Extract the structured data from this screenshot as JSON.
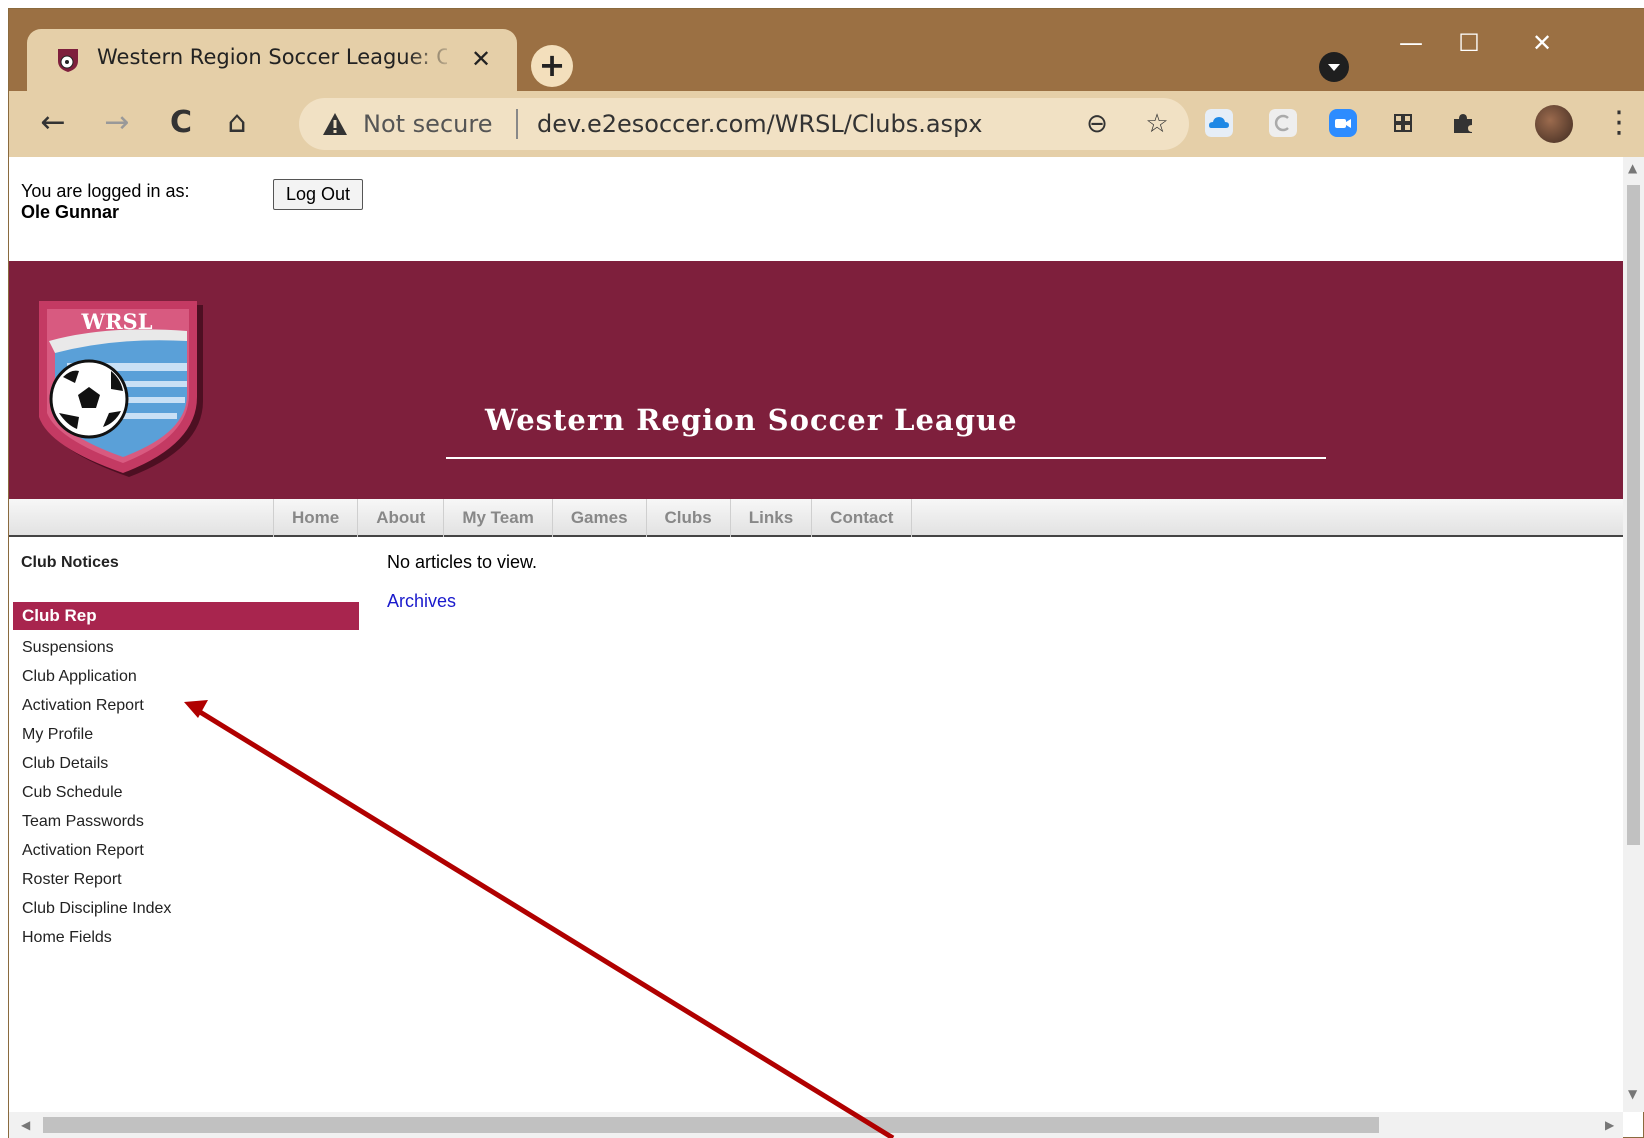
{
  "browser": {
    "tab_title": "Western Region Soccer League: C",
    "tab_close": "✕",
    "new_tab": "+",
    "window": {
      "minimize": "—",
      "maximize": "☐",
      "close": "✕"
    },
    "nav": {
      "back": "←",
      "forward": "→",
      "reload": "C",
      "home": "⌂"
    },
    "security_label": "Not secure",
    "url": "dev.e2esoccer.com/WRSL/Clubs.aspx",
    "zoom_icon": "⊖",
    "star_icon": "☆",
    "menu_icon": "⋮"
  },
  "login": {
    "label": "You are logged in as:",
    "user": "Ole Gunnar",
    "logout_label": "Log Out"
  },
  "banner": {
    "crest_text": "WRSL",
    "title": "Western Region Soccer League"
  },
  "nav_items": [
    "Home",
    "About",
    "My Team",
    "Games",
    "Clubs",
    "Links",
    "Contact"
  ],
  "sidebar": {
    "notices_heading": "Club Notices",
    "section_title": "Club Rep",
    "items": [
      "Suspensions",
      "Club Application",
      "Activation Report",
      "My Profile",
      "Club Details",
      "Cub Schedule",
      "Team Passwords",
      "Activation Report",
      "Roster Report",
      "Club Discipline Index",
      "Home Fields"
    ]
  },
  "main": {
    "message": "No articles to view.",
    "archives_link": "Archives"
  },
  "colors": {
    "banner": "#7e1f3c",
    "club_rep_header": "#a8254e",
    "annotation_arrow": "#b00000"
  }
}
